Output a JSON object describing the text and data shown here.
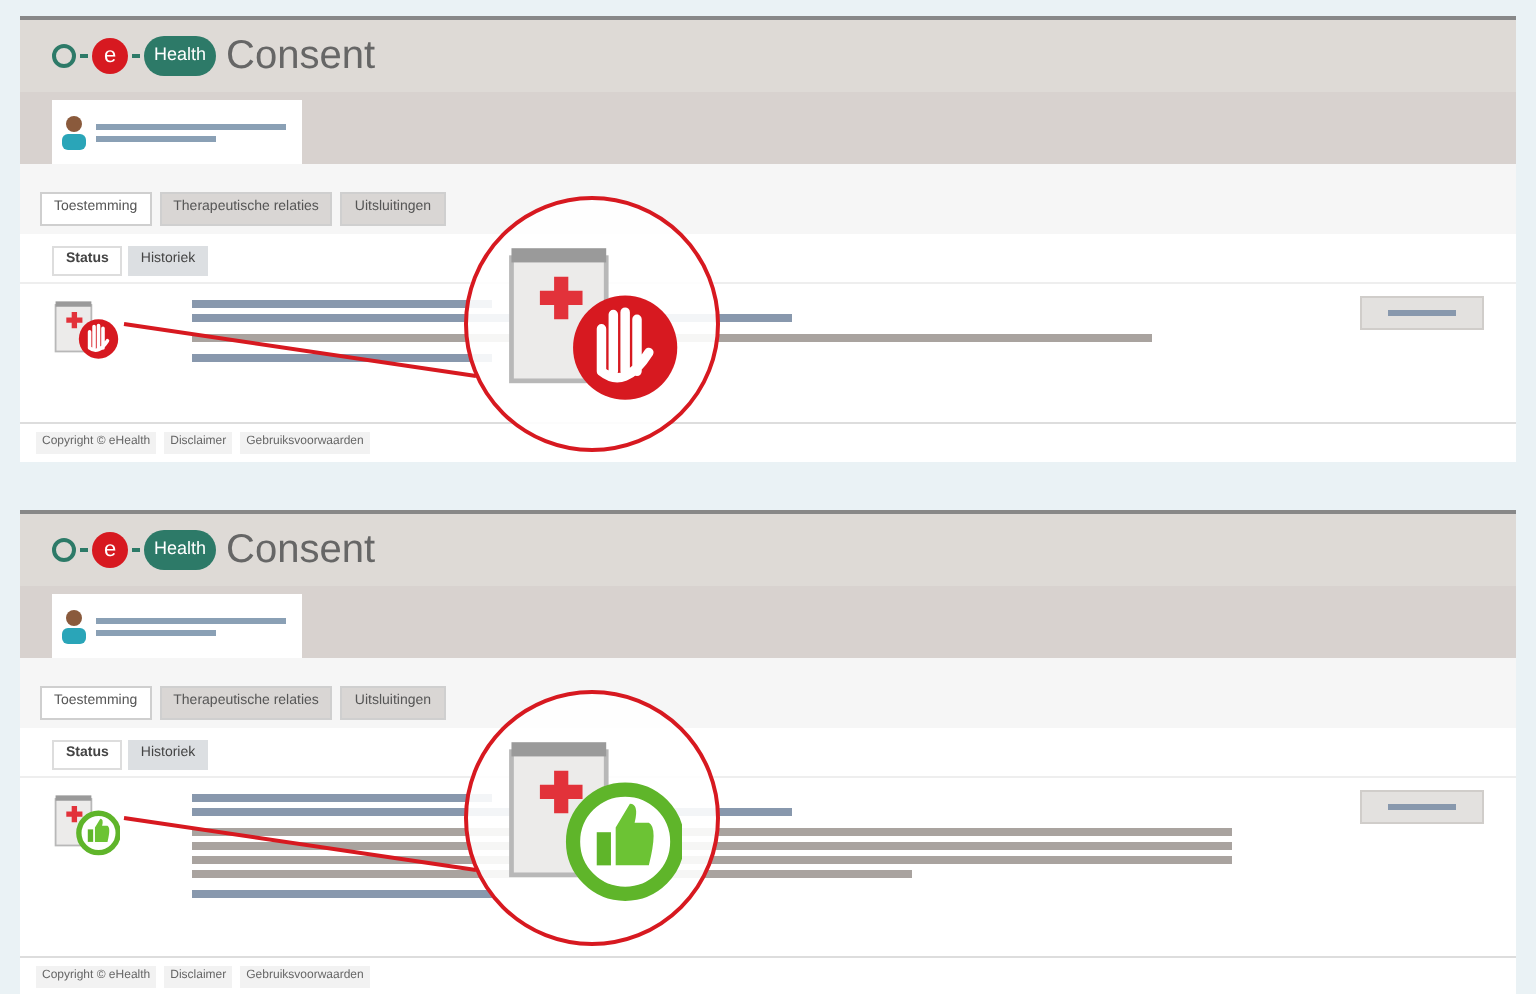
{
  "screens": [
    {
      "logo": {
        "letter": "e",
        "badge": "Health",
        "title": "Consent"
      },
      "tabs": [
        {
          "label": "Toestemming",
          "selected": true
        },
        {
          "label": "Therapeutische relaties",
          "selected": false
        },
        {
          "label": "Uitsluitingen",
          "selected": false
        }
      ],
      "subtabs": [
        {
          "label": "Status",
          "selected": true
        },
        {
          "label": "Historiek",
          "selected": false
        }
      ],
      "status": {
        "kind": "refused"
      },
      "footer": [
        "Copyright © eHealth",
        "Disclaimer",
        "Gebruiksvoorwaarden"
      ]
    },
    {
      "logo": {
        "letter": "e",
        "badge": "Health",
        "title": "Consent"
      },
      "tabs": [
        {
          "label": "Toestemming",
          "selected": true
        },
        {
          "label": "Therapeutische relaties",
          "selected": false
        },
        {
          "label": "Uitsluitingen",
          "selected": false
        }
      ],
      "subtabs": [
        {
          "label": "Status",
          "selected": true
        },
        {
          "label": "Historiek",
          "selected": false
        }
      ],
      "status": {
        "kind": "granted"
      },
      "footer": [
        "Copyright © eHealth",
        "Disclaimer",
        "Gebruiksvoorwaarden"
      ]
    }
  ]
}
